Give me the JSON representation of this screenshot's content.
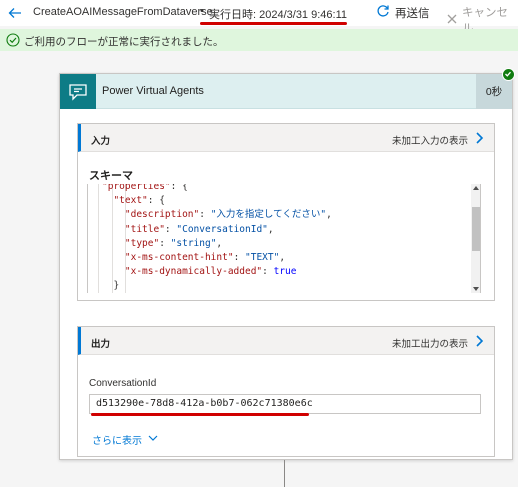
{
  "topbar": {
    "flow_name": "CreateAOAIMessageFromDataverse",
    "separator": "•",
    "run_time": "実行日時: 2024/3/31 9:46:11",
    "resubmit_label": "再送信",
    "cancel_label": "キャンセル"
  },
  "status": {
    "message": "ご利用のフローが正常に実行されました。"
  },
  "action": {
    "title": "Power Virtual Agents",
    "duration": "0秒",
    "input": {
      "title": "入力",
      "raw_link": "未加工入力の表示",
      "schema_label": "スキーマ",
      "code": [
        [
          {
            "t": "\"properties\"",
            "c": "k"
          },
          {
            "t": ": {",
            "c": "p"
          }
        ],
        [
          {
            "t": "  \"text\"",
            "c": "k"
          },
          {
            "t": ": {",
            "c": "p"
          }
        ],
        [
          {
            "t": "    \"description\"",
            "c": "k"
          },
          {
            "t": ": ",
            "c": "p"
          },
          {
            "t": "\"入力を指定してください\"",
            "c": "s"
          },
          {
            "t": ",",
            "c": "p"
          }
        ],
        [
          {
            "t": "    \"title\"",
            "c": "k"
          },
          {
            "t": ": ",
            "c": "p"
          },
          {
            "t": "\"ConversationId\"",
            "c": "s"
          },
          {
            "t": ",",
            "c": "p"
          }
        ],
        [
          {
            "t": "    \"type\"",
            "c": "k"
          },
          {
            "t": ": ",
            "c": "p"
          },
          {
            "t": "\"string\"",
            "c": "s"
          },
          {
            "t": ",",
            "c": "p"
          }
        ],
        [
          {
            "t": "    \"x-ms-content-hint\"",
            "c": "k"
          },
          {
            "t": ": ",
            "c": "p"
          },
          {
            "t": "\"TEXT\"",
            "c": "s"
          },
          {
            "t": ",",
            "c": "p"
          }
        ],
        [
          {
            "t": "    \"x-ms-dynamically-added\"",
            "c": "k"
          },
          {
            "t": ": ",
            "c": "p"
          },
          {
            "t": "true",
            "c": "b"
          }
        ],
        [
          {
            "t": "  }",
            "c": "p"
          }
        ]
      ]
    },
    "output": {
      "title": "出力",
      "raw_link": "未加工出力の表示",
      "field_label": "ConversationId",
      "field_value": "d513290e-78d8-412a-b0b7-062c71380e6c",
      "show_more": "さらに表示"
    }
  },
  "colors": {
    "accent": "#0078d4",
    "success_bg": "#dff6dd",
    "success": "#107c10",
    "header_bg": "#ddeff0",
    "pva_icon_bg": "#0e7c86",
    "annotation": "#d00000"
  },
  "icons": [
    "back-arrow-icon",
    "resubmit-icon",
    "cancel-icon",
    "check-circle-icon",
    "chat-icon",
    "chevron-right-icon",
    "chevron-down-icon"
  ]
}
